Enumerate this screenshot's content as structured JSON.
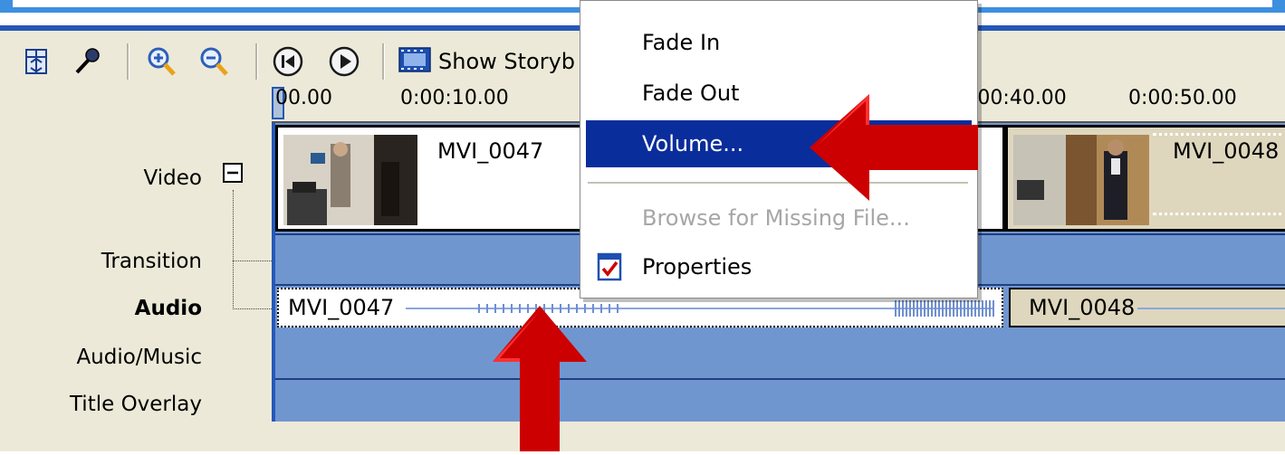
{
  "toolbar": {
    "show_storyboard_label": "Show Storyb"
  },
  "ruler": {
    "tick_labels": [
      "00.00",
      "0:00:10.00",
      ":00:40.00",
      "0:00:50.00"
    ]
  },
  "tracks": {
    "video": "Video",
    "transition": "Transition",
    "audio": "Audio",
    "audio_music": "Audio/Music",
    "title_overlay": "Title Overlay"
  },
  "clips": {
    "video": [
      {
        "name": "MVI_0047"
      },
      {
        "name": "MVI_0048"
      }
    ],
    "audio": [
      {
        "name": "MVI_0047"
      },
      {
        "name": "MVI_0048"
      }
    ]
  },
  "context_menu": {
    "items": [
      {
        "label": "Fade In",
        "state": "normal"
      },
      {
        "label": "Fade Out",
        "state": "normal"
      },
      {
        "label": "Volume...",
        "state": "selected"
      },
      {
        "label": "Browse for Missing File...",
        "state": "disabled"
      },
      {
        "label": "Properties",
        "state": "normal"
      }
    ]
  },
  "colors": {
    "accent_blue": "#2458b8",
    "track_blue": "#7096d0",
    "menu_selected": "#0a2d9c",
    "arrow_red": "#cc0000",
    "panel_bg": "#ece9d8"
  },
  "icons": {
    "toolbar": [
      "storyboard-set-icon",
      "narrate-microphone-icon",
      "zoom-in-icon",
      "zoom-out-icon",
      "rewind-icon",
      "play-icon",
      "filmstrip-icon"
    ],
    "track_collapse": "collapse-minus-icon",
    "properties": "properties-check-icon"
  }
}
